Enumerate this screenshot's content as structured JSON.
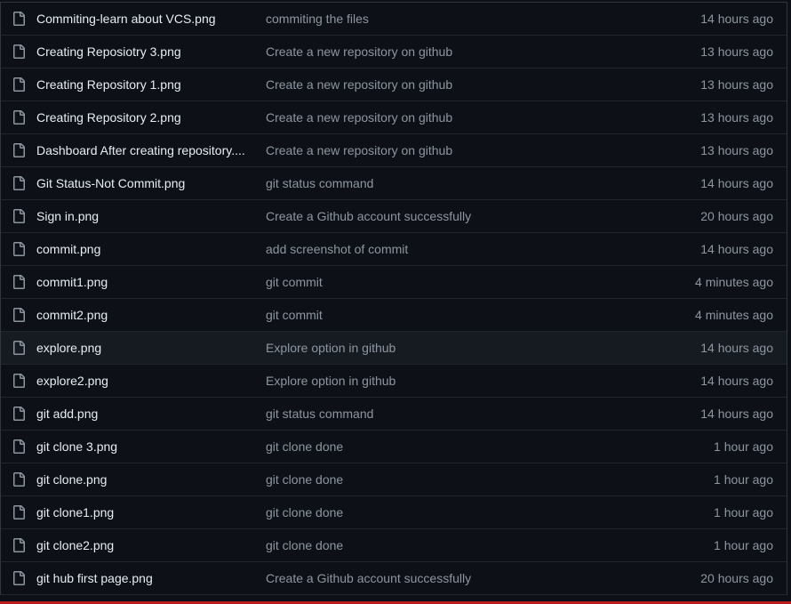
{
  "files": [
    {
      "name": "Commiting-learn about VCS.png",
      "message": "commiting the files",
      "time": "14 hours ago"
    },
    {
      "name": "Creating Reposiotry 3.png",
      "message": "Create a new repository on github",
      "time": "13 hours ago"
    },
    {
      "name": "Creating Repository 1.png",
      "message": "Create a new repository on github",
      "time": "13 hours ago"
    },
    {
      "name": "Creating Repository 2.png",
      "message": "Create a new repository on github",
      "time": "13 hours ago"
    },
    {
      "name": "Dashboard After creating repository....",
      "message": "Create a new repository on github",
      "time": "13 hours ago"
    },
    {
      "name": "Git Status-Not Commit.png",
      "message": "git status command",
      "time": "14 hours ago"
    },
    {
      "name": "Sign in.png",
      "message": "Create a Github account successfully",
      "time": "20 hours ago"
    },
    {
      "name": "commit.png",
      "message": "add screenshot of commit",
      "time": "14 hours ago"
    },
    {
      "name": "commit1.png",
      "message": "git commit",
      "time": "4 minutes ago"
    },
    {
      "name": "commit2.png",
      "message": "git commit",
      "time": "4 minutes ago"
    },
    {
      "name": "explore.png",
      "message": "Explore option in github",
      "time": "14 hours ago"
    },
    {
      "name": "explore2.png",
      "message": "Explore option in github",
      "time": "14 hours ago"
    },
    {
      "name": "git add.png",
      "message": "git status command",
      "time": "14 hours ago"
    },
    {
      "name": "git clone 3.png",
      "message": "git clone done",
      "time": "1 hour ago"
    },
    {
      "name": "git clone.png",
      "message": "git clone done",
      "time": "1 hour ago"
    },
    {
      "name": "git clone1.png",
      "message": "git clone done",
      "time": "1 hour ago"
    },
    {
      "name": "git clone2.png",
      "message": "git clone done",
      "time": "1 hour ago"
    },
    {
      "name": "git hub first page.png",
      "message": "Create a Github account successfully",
      "time": "20 hours ago"
    }
  ],
  "icons": {
    "file": "file-icon"
  },
  "colors": {
    "background": "#0d1117",
    "row_hover": "#161b22",
    "border": "#21262d",
    "text": "#e6edf3",
    "muted": "#8d96a0",
    "bottom_accent": "#b91c1c"
  }
}
